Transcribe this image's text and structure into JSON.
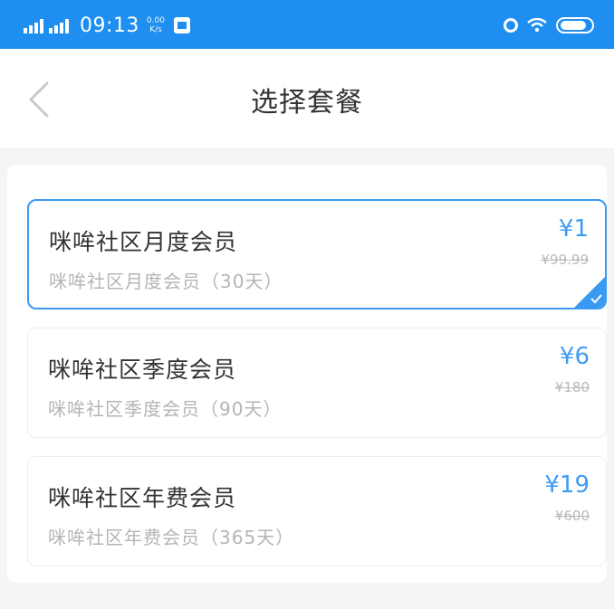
{
  "status_bar": {
    "time": "09:13",
    "speed_value": "0.00",
    "speed_unit": "K/s"
  },
  "header": {
    "title": "选择套餐"
  },
  "plans": [
    {
      "name": "咪哞社区月度会员",
      "description": "咪哞社区月度会员（30天）",
      "price": "¥1",
      "original_price": "¥99.99",
      "selected": true
    },
    {
      "name": "咪哞社区季度会员",
      "description": "咪哞社区季度会员（90天）",
      "price": "¥6",
      "original_price": "¥180",
      "selected": false
    },
    {
      "name": "咪哞社区年费会员",
      "description": "咪哞社区年费会员（365天）",
      "price": "¥19",
      "original_price": "¥600",
      "selected": false
    }
  ],
  "colors": {
    "status_bar": "#1e8ff0",
    "accent": "#3d9cf2",
    "title_text": "#333333",
    "muted_text": "#b5b5b5"
  }
}
